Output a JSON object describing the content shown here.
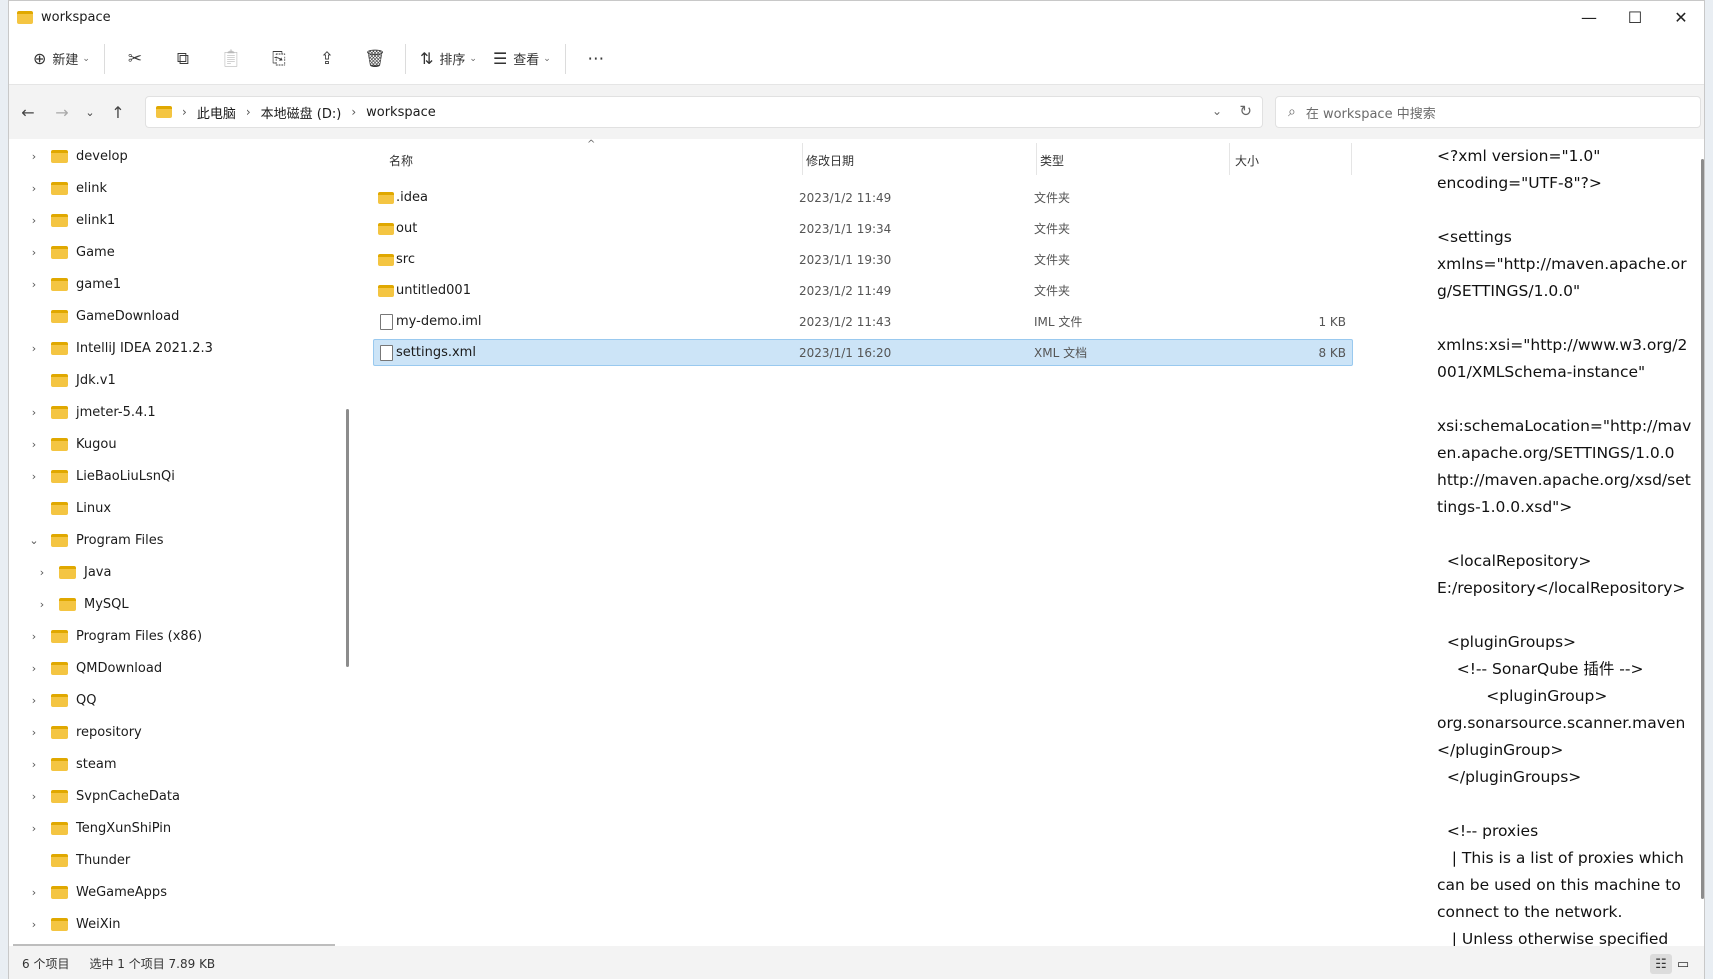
{
  "window": {
    "title": "workspace"
  },
  "toolbar": {
    "new_label": "新建",
    "sort_label": "排序",
    "view_label": "查看"
  },
  "address": {
    "crumbs": [
      "此电脑",
      "本地磁盘 (D:)",
      "workspace"
    ],
    "search_placeholder": "在 workspace 中搜索"
  },
  "nav": {
    "items": [
      {
        "label": "develop",
        "expand": "›",
        "indent": 0
      },
      {
        "label": "elink",
        "expand": "›",
        "indent": 0
      },
      {
        "label": "elink1",
        "expand": "›",
        "indent": 0
      },
      {
        "label": "Game",
        "expand": "›",
        "indent": 0
      },
      {
        "label": "game1",
        "expand": "›",
        "indent": 0
      },
      {
        "label": "GameDownload",
        "expand": "",
        "indent": 0
      },
      {
        "label": "IntelliJ IDEA 2021.2.3",
        "expand": "›",
        "indent": 0
      },
      {
        "label": "Jdk.v1",
        "expand": "",
        "indent": 0
      },
      {
        "label": "jmeter-5.4.1",
        "expand": "›",
        "indent": 0
      },
      {
        "label": "Kugou",
        "expand": "›",
        "indent": 0
      },
      {
        "label": "LieBaoLiuLsnQi",
        "expand": "›",
        "indent": 0
      },
      {
        "label": "Linux",
        "expand": "",
        "indent": 0
      },
      {
        "label": "Program Files",
        "expand": "⌄",
        "indent": 0
      },
      {
        "label": "Java",
        "expand": "›",
        "indent": 1
      },
      {
        "label": "MySQL",
        "expand": "›",
        "indent": 1
      },
      {
        "label": "Program Files (x86)",
        "expand": "›",
        "indent": 0
      },
      {
        "label": "QMDownload",
        "expand": "›",
        "indent": 0
      },
      {
        "label": "QQ",
        "expand": "›",
        "indent": 0
      },
      {
        "label": "repository",
        "expand": "›",
        "indent": 0
      },
      {
        "label": "steam",
        "expand": "›",
        "indent": 0
      },
      {
        "label": "SvpnCacheData",
        "expand": "›",
        "indent": 0
      },
      {
        "label": "TengXunShiPin",
        "expand": "›",
        "indent": 0
      },
      {
        "label": "Thunder",
        "expand": "",
        "indent": 0
      },
      {
        "label": "WeGameApps",
        "expand": "›",
        "indent": 0
      },
      {
        "label": "WeiXin",
        "expand": "›",
        "indent": 0
      }
    ]
  },
  "files": {
    "columns": {
      "name": "名称",
      "date": "修改日期",
      "type": "类型",
      "size": "大小"
    },
    "rows": [
      {
        "name": ".idea",
        "date": "2023/1/2 11:49",
        "type": "文件夹",
        "size": "",
        "kind": "folder",
        "selected": false
      },
      {
        "name": "out",
        "date": "2023/1/1 19:34",
        "type": "文件夹",
        "size": "",
        "kind": "folder",
        "selected": false
      },
      {
        "name": "src",
        "date": "2023/1/1 19:30",
        "type": "文件夹",
        "size": "",
        "kind": "folder",
        "selected": false
      },
      {
        "name": "untitled001",
        "date": "2023/1/2 11:49",
        "type": "文件夹",
        "size": "",
        "kind": "folder",
        "selected": false
      },
      {
        "name": "my-demo.iml",
        "date": "2023/1/2 11:43",
        "type": "IML 文件",
        "size": "1 KB",
        "kind": "file",
        "selected": false
      },
      {
        "name": "settings.xml",
        "date": "2023/1/1 16:20",
        "type": "XML 文档",
        "size": "8 KB",
        "kind": "file",
        "selected": true
      }
    ]
  },
  "preview": {
    "text": "<?xml version=\"1.0\"\nencoding=\"UTF-8\"?>\n\n<settings\nxmlns=\"http://maven.apache.or\ng/SETTINGS/1.0.0\"\n\nxmlns:xsi=\"http://www.w3.org/2\n001/XMLSchema-instance\"\n\nxsi:schemaLocation=\"http://mav\nen.apache.org/SETTINGS/1.0.0\nhttp://maven.apache.org/xsd/set\ntings-1.0.0.xsd\">\n\n  <localRepository>\nE:/repository</localRepository>\n\n  <pluginGroups>\n    <!-- SonarQube 插件 -->\n          <pluginGroup>\norg.sonarsource.scanner.maven\n</pluginGroup>\n  </pluginGroups>\n\n  <!-- proxies\n   | This is a list of proxies which\ncan be used on this machine to\nconnect to the network.\n   | Unless otherwise specified"
  },
  "status": {
    "count": "6 个项目",
    "selection": "选中 1 个项目  7.89 KB"
  }
}
